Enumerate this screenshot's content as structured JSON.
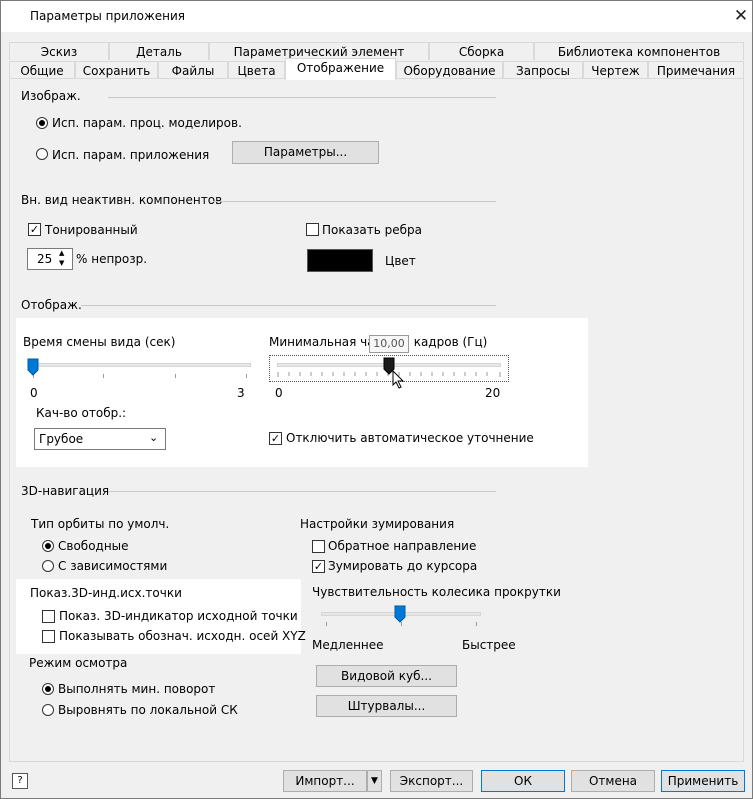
{
  "window": {
    "title": "Параметры приложения",
    "close_icon": "close-icon"
  },
  "tabs": {
    "row1": [
      "Эскиз",
      "Деталь",
      "Параметрический элемент",
      "Сборка",
      "Библиотека компонентов"
    ],
    "row2": [
      "Общие",
      "Сохранить",
      "Файлы",
      "Цвета",
      "Отображение",
      "Оборудование",
      "Запросы",
      "Чертеж",
      "Примечания"
    ],
    "active": "Отображение"
  },
  "appearance": {
    "heading": "Изображ.",
    "radio1": "Исп. парам. проц. моделиров.",
    "radio2": "Исп. парам. приложения",
    "params_button": "Параметры..."
  },
  "inactive": {
    "heading": "Вн. вид неактивн. компонентов",
    "shaded": "Тонированный",
    "show_edges": "Показать ребра",
    "opacity_value": "25",
    "opacity_label": "% непрозр.",
    "color_label": "Цвет",
    "color_swatch": "#000000"
  },
  "display": {
    "heading": "Отображ.",
    "view_time_label": "Время смены вида (сек)",
    "view_time_min": "0",
    "view_time_max": "3",
    "view_time_value": 0,
    "fps_label": "Минимальная частота кадров (Гц)",
    "fps_tooltip": "10,00",
    "fps_min": "0",
    "fps_max": "20",
    "fps_value": 10,
    "quality_label": "Кач-во отобр.:",
    "quality_value": "Грубое",
    "disable_refine": "Отключить автоматическое уточнение"
  },
  "nav3d": {
    "heading": "3D-навигация",
    "orbit_label": "Тип орбиты по умолч.",
    "orbit_free": "Свободные",
    "orbit_constrained": "С зависимостями",
    "zoom_label": "Настройки зумирования",
    "zoom_reverse": "Обратное направление",
    "zoom_cursor": "Зумировать до курсора",
    "origin_label": "Показ.3D-инд.исх.точки",
    "origin_indicator": "Показ. 3D-индикатор исходной точки",
    "origin_axes": "Показывать обознач. исходн. осей XYZ",
    "wheel_label": "Чувствительность колесика прокрутки",
    "wheel_slow": "Медленнее",
    "wheel_fast": "Быстрее",
    "wheel_value": 0.5,
    "look_label": "Режим осмотра",
    "look_min": "Выполнять мин. поворот",
    "look_local": "Выровнять по локальной СК",
    "viewcube_button": "Видовой куб...",
    "wheels_button": "Штурвалы..."
  },
  "footer": {
    "import": "Импорт...",
    "export": "Экспорт...",
    "ok": "ОК",
    "cancel": "Отмена",
    "apply": "Применить"
  },
  "colors": {
    "accent": "#0078d7",
    "highlight": "#ffffff"
  }
}
